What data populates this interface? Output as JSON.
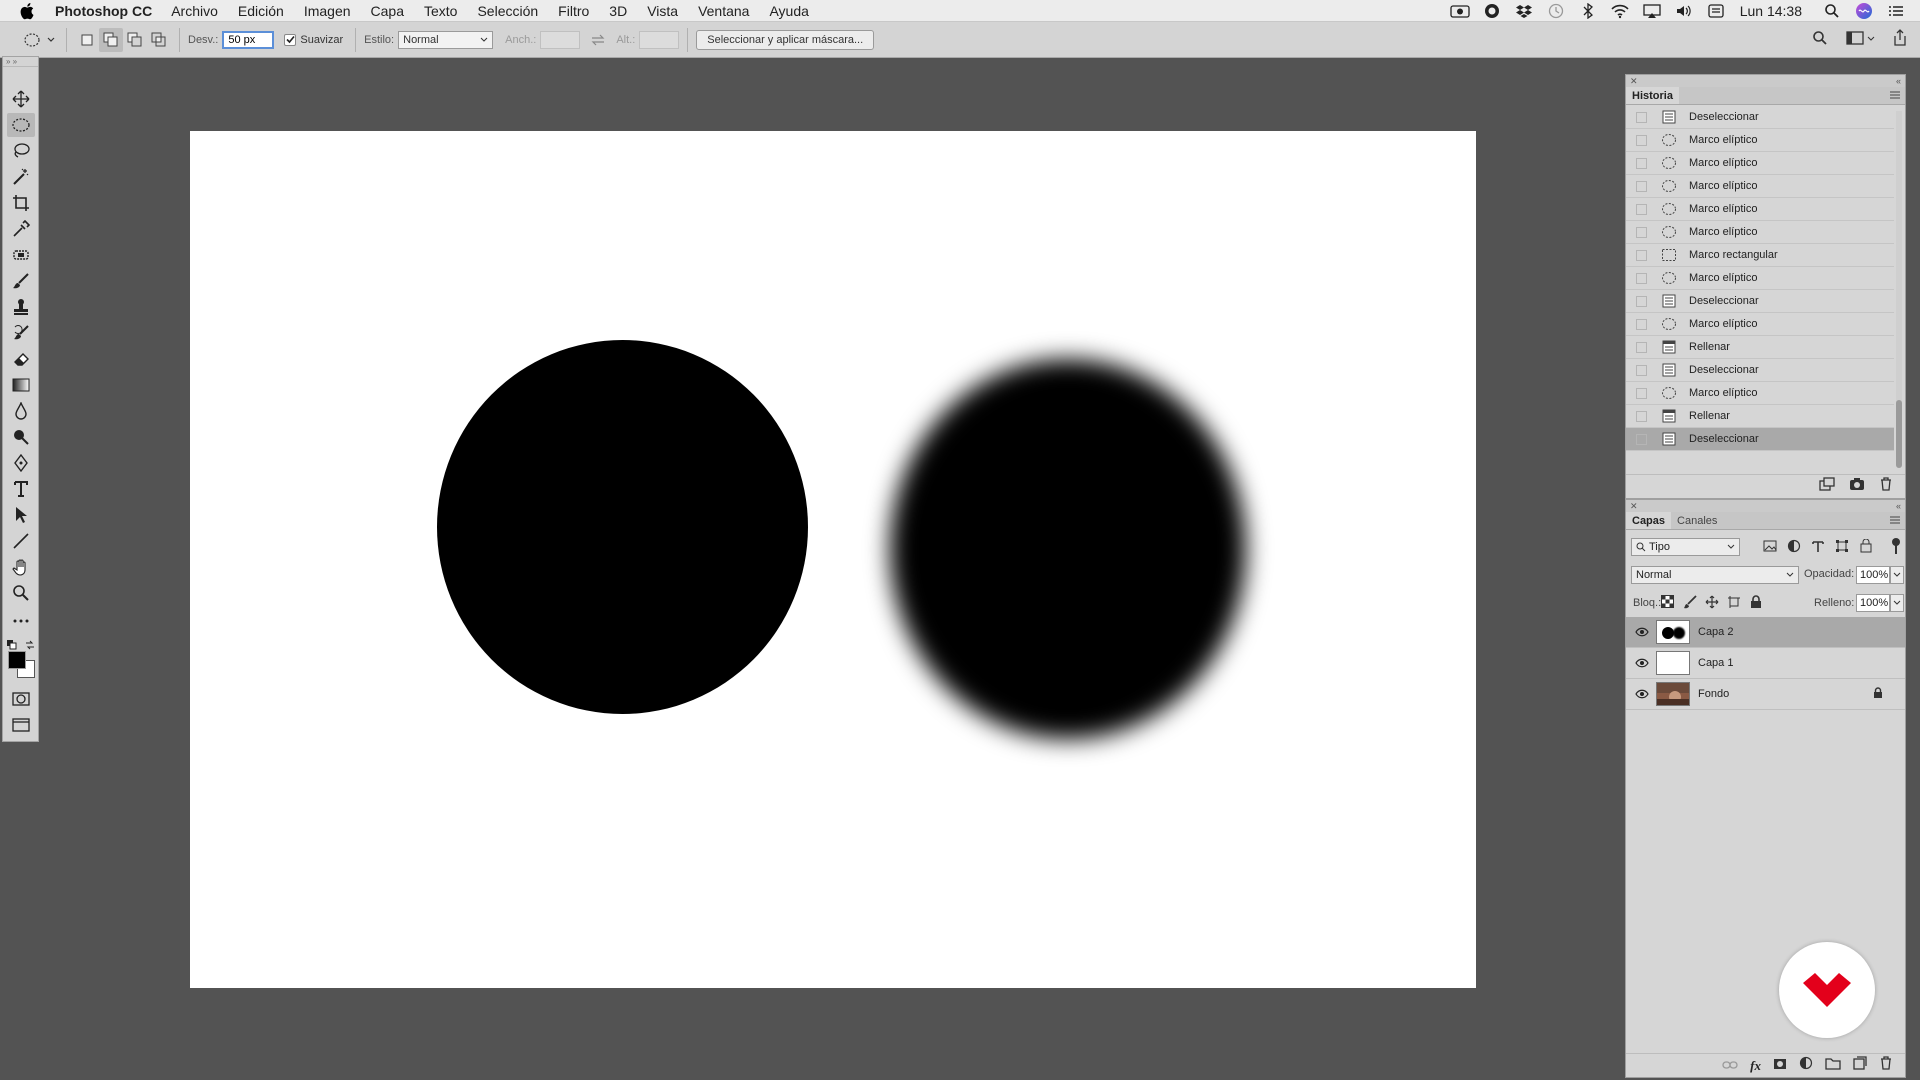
{
  "menubar": {
    "app_name": "Photoshop CC",
    "items": [
      "Archivo",
      "Edición",
      "Imagen",
      "Capa",
      "Texto",
      "Selección",
      "Filtro",
      "3D",
      "Vista",
      "Ventana",
      "Ayuda"
    ],
    "clock": "Lun 14:38"
  },
  "optionsbar": {
    "feather_label": "Desv.:",
    "feather_value": "50 px",
    "antialias_label": "Suavizar",
    "antialias_checked": true,
    "style_label": "Estilo:",
    "style_value": "Normal",
    "width_label": "Anch.:",
    "height_label": "Alt.:",
    "select_mask_button": "Seleccionar y aplicar máscara..."
  },
  "history": {
    "tab": "Historia",
    "items": [
      {
        "label": "Deseleccionar",
        "icon": "doc-icon"
      },
      {
        "label": "Marco elíptico",
        "icon": "ellipse-icon"
      },
      {
        "label": "Marco elíptico",
        "icon": "ellipse-icon"
      },
      {
        "label": "Marco elíptico",
        "icon": "ellipse-icon"
      },
      {
        "label": "Marco elíptico",
        "icon": "ellipse-icon"
      },
      {
        "label": "Marco elíptico",
        "icon": "ellipse-icon"
      },
      {
        "label": "Marco rectangular",
        "icon": "rect-icon"
      },
      {
        "label": "Marco elíptico",
        "icon": "ellipse-icon"
      },
      {
        "label": "Deseleccionar",
        "icon": "doc-icon"
      },
      {
        "label": "Marco elíptico",
        "icon": "ellipse-icon"
      },
      {
        "label": "Rellenar",
        "icon": "fill-icon"
      },
      {
        "label": "Deseleccionar",
        "icon": "doc-icon"
      },
      {
        "label": "Marco elíptico",
        "icon": "ellipse-icon"
      },
      {
        "label": "Rellenar",
        "icon": "fill-icon"
      },
      {
        "label": "Deseleccionar",
        "icon": "doc-icon"
      }
    ],
    "active_index": 14
  },
  "layers": {
    "tabs": [
      "Capas",
      "Canales"
    ],
    "filter_value": "Tipo",
    "blend_mode": "Normal",
    "opacity_label": "Opacidad:",
    "opacity_value": "100%",
    "lock_label": "Bloq.:",
    "fill_label": "Relleno:",
    "fill_value": "100%",
    "items": [
      {
        "name": "Capa 2",
        "selected": true,
        "locked": false
      },
      {
        "name": "Capa 1",
        "selected": false,
        "locked": false
      },
      {
        "name": "Fondo",
        "selected": false,
        "locked": true
      }
    ]
  },
  "colors": {
    "foreground": "#000000",
    "background": "#ffffff",
    "watermark": "#e3001b"
  }
}
